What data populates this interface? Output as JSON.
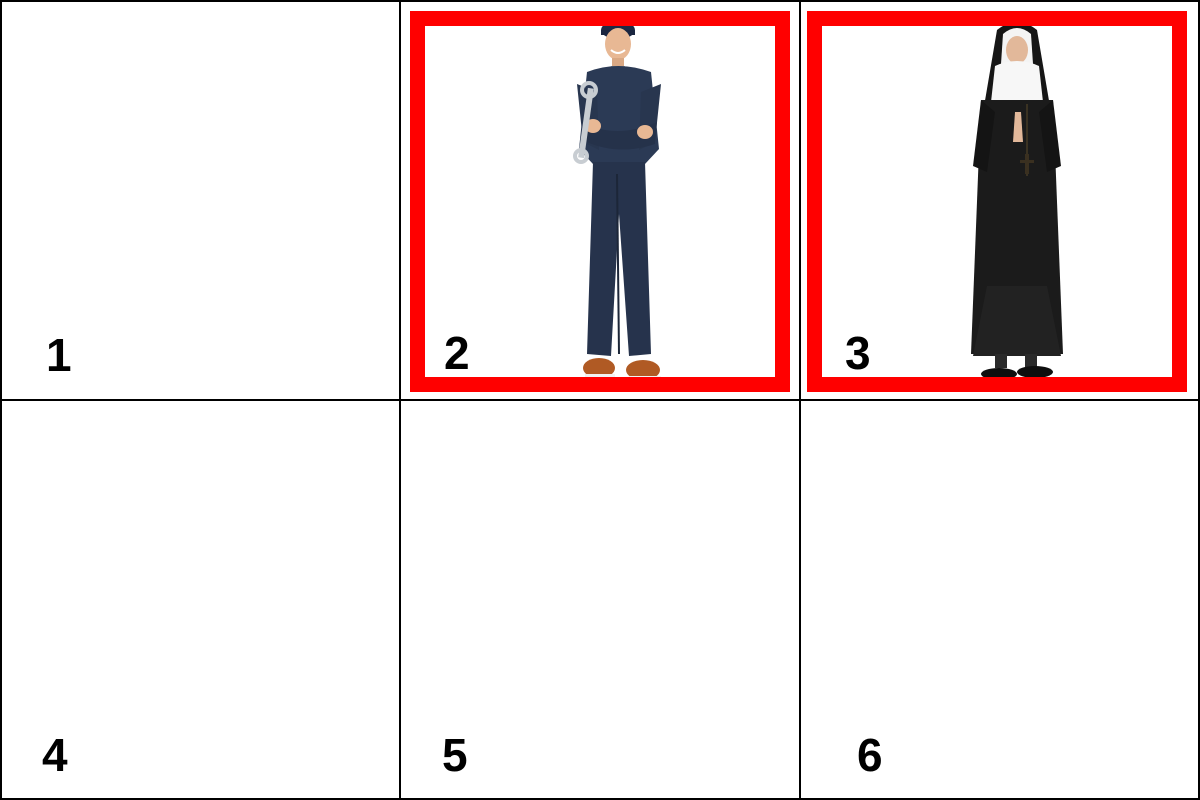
{
  "cells": [
    {
      "label": "1",
      "selected": false,
      "image": ""
    },
    {
      "label": "2",
      "selected": true,
      "image": "mechanic-photo"
    },
    {
      "label": "3",
      "selected": true,
      "image": "nun-photo"
    },
    {
      "label": "4",
      "selected": false,
      "image": ""
    },
    {
      "label": "5",
      "selected": false,
      "image": ""
    },
    {
      "label": "6",
      "selected": false,
      "image": ""
    }
  ],
  "colors": {
    "selection": "#ff0000",
    "grid_line": "#000000",
    "background": "#ffffff"
  }
}
